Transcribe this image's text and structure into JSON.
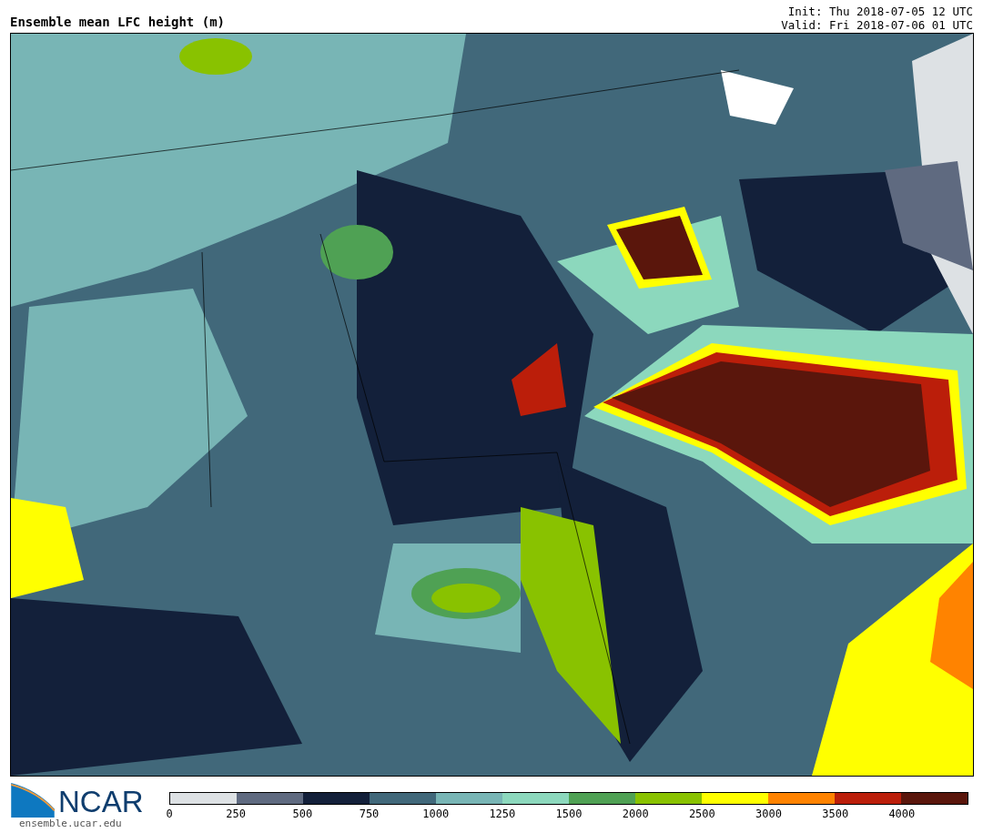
{
  "title": "Ensemble mean LFC height (m)",
  "init": "Init: Thu 2018-07-05 12 UTC",
  "valid": "Valid: Fri 2018-07-06 01 UTC",
  "logo": {
    "text": "NCAR",
    "url": "ensemble.ucar.edu"
  },
  "colorbar": {
    "bins": [
      {
        "color": "#dde1e4"
      },
      {
        "color": "#5f6a80"
      },
      {
        "color": "#13203a"
      },
      {
        "color": "#41687a"
      },
      {
        "color": "#78b5b5"
      },
      {
        "color": "#8cd8bd"
      },
      {
        "color": "#4fa154"
      },
      {
        "color": "#89c200"
      },
      {
        "color": "#ffff00"
      },
      {
        "color": "#ff8300"
      },
      {
        "color": "#bb1e0a"
      },
      {
        "color": "#5a160c"
      }
    ],
    "ticks": [
      "0",
      "250",
      "500",
      "750",
      "1000",
      "1250",
      "1500",
      "2000",
      "2500",
      "3000",
      "3500",
      "4000"
    ]
  }
}
